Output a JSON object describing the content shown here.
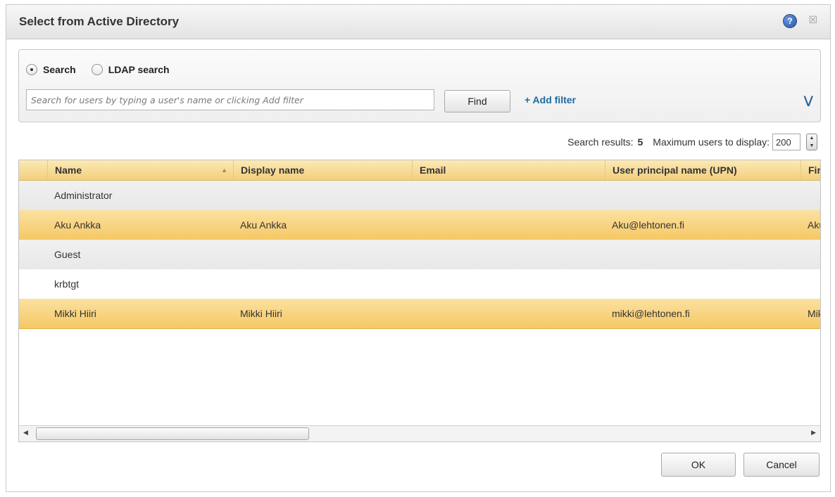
{
  "dialog": {
    "title": "Select from Active Directory",
    "help_icon_glyph": "?",
    "close_icon_glyph": "☒"
  },
  "search": {
    "mode_search_label": "Search",
    "mode_ldap_label": "LDAP search",
    "selected_mode": "Search",
    "placeholder": "Search for users by typing a user's name or clicking Add filter",
    "value": "",
    "find_label": "Find",
    "add_filter_label": "+ Add filter",
    "expand_icon": "chevron-double-down-icon"
  },
  "results": {
    "label": "Search results:",
    "count": "5",
    "max_label": "Maximum users to display:",
    "max_value": "200"
  },
  "grid": {
    "columns": [
      {
        "label": "Name",
        "sorted": "asc"
      },
      {
        "label": "Display name"
      },
      {
        "label": "Email"
      },
      {
        "label": "User principal name (UPN)"
      },
      {
        "label": "Firs"
      }
    ],
    "rows": [
      {
        "name": "Administrator",
        "display": "",
        "email": "",
        "upn": "",
        "first": "",
        "state": "alt"
      },
      {
        "name": "Aku Ankka",
        "display": "Aku Ankka",
        "email": "",
        "upn": "Aku@lehtonen.fi",
        "first": "Aku",
        "state": "selected"
      },
      {
        "name": "Guest",
        "display": "",
        "email": "",
        "upn": "",
        "first": "",
        "state": "alt"
      },
      {
        "name": "krbtgt",
        "display": "",
        "email": "",
        "upn": "",
        "first": "",
        "state": "plain"
      },
      {
        "name": "Mikki Hiiri",
        "display": "Mikki Hiiri",
        "email": "",
        "upn": "mikki@lehtonen.fi",
        "first": "Mik",
        "state": "selected"
      }
    ]
  },
  "buttons": {
    "ok_label": "OK",
    "cancel_label": "Cancel"
  },
  "colors": {
    "selected_row": "#f5c865",
    "header": "#f4cf7c",
    "link": "#1c6ba0"
  }
}
